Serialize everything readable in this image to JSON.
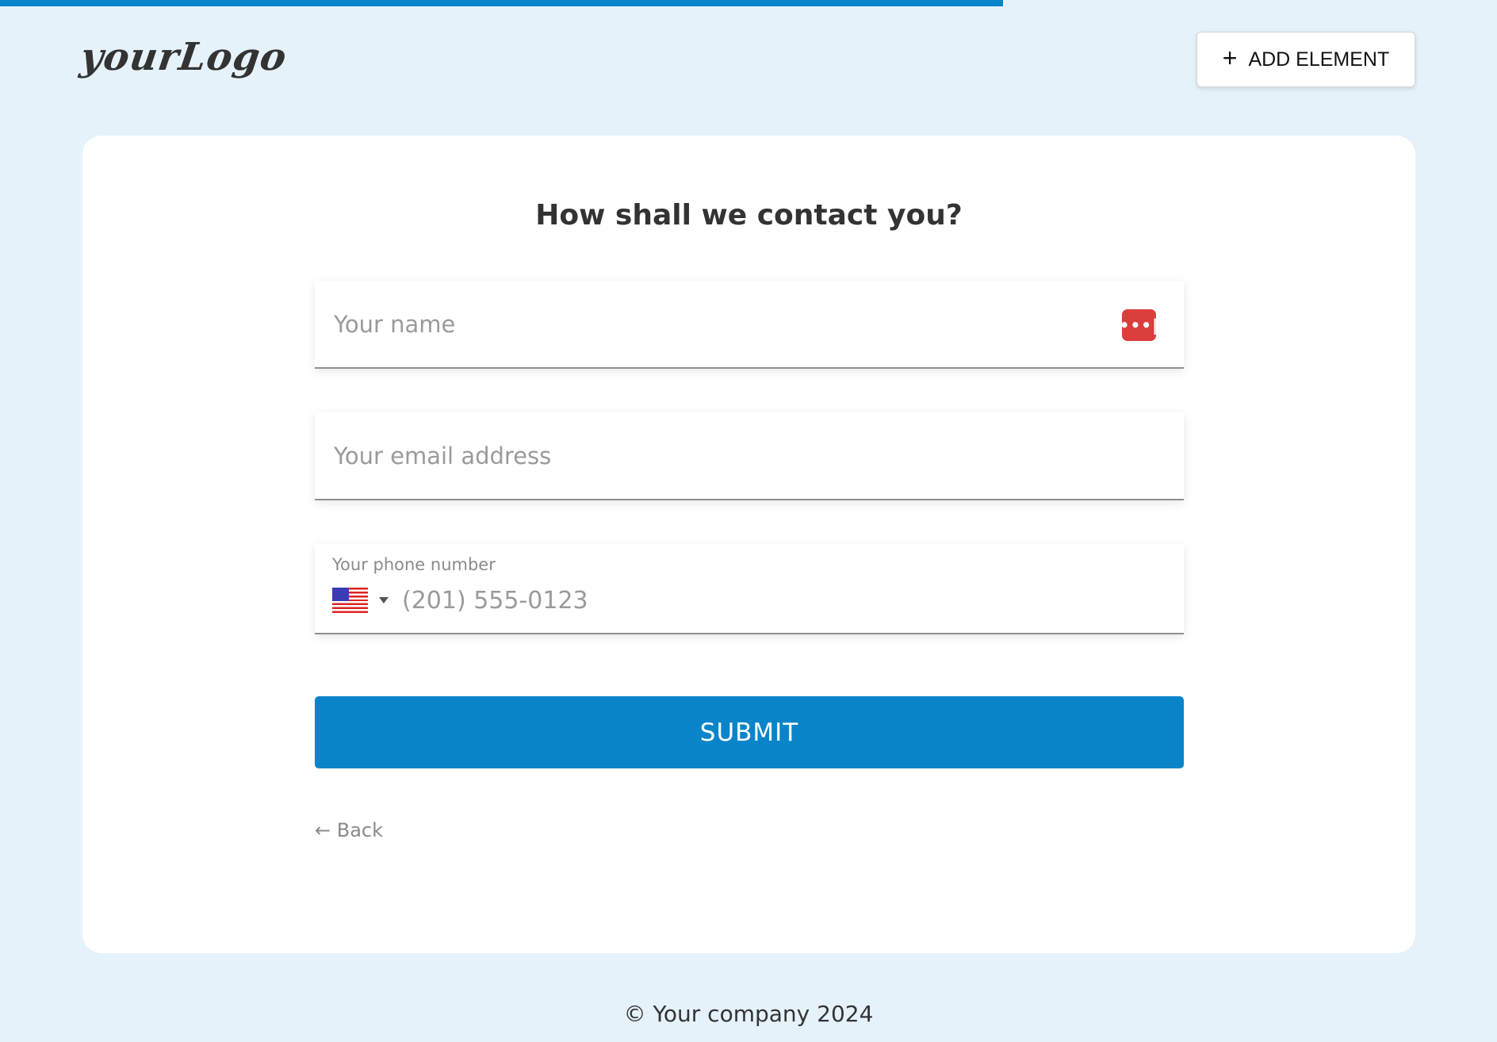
{
  "progress": {
    "fraction": 0.67,
    "color": "#0a84c8"
  },
  "header": {
    "logo_text": "yourLogo",
    "add_element": {
      "icon": "plus-icon",
      "label": "ADD ELEMENT"
    }
  },
  "form": {
    "title": "How shall we contact you?",
    "name": {
      "placeholder": "Your name",
      "value": "",
      "autofill_icon": "password-manager-icon"
    },
    "email": {
      "placeholder": "Your email address",
      "value": ""
    },
    "phone": {
      "label": "Your phone number",
      "country": "US",
      "country_icon": "us-flag-icon",
      "placeholder": "(201) 555-0123",
      "value": ""
    },
    "submit_label": "SUBMIT",
    "back_label": "← Back"
  },
  "footer": {
    "text": "© Your company 2024"
  },
  "colors": {
    "accent": "#0a84c8",
    "background": "#e5f2fa",
    "autofill": "#dc3d3d"
  }
}
